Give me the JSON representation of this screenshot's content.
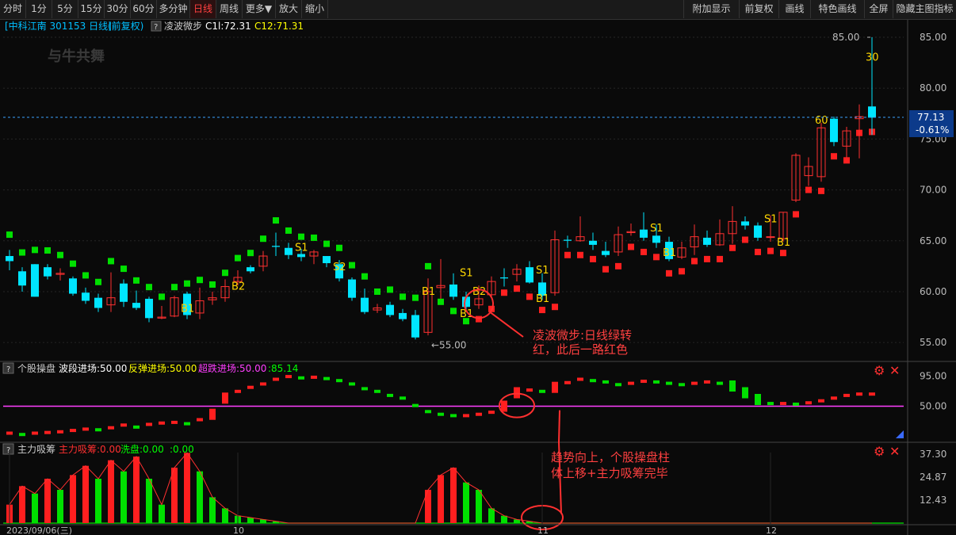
{
  "toolbar": {
    "left": [
      "分时",
      "1分",
      "5分",
      "15分",
      "30分",
      "60分",
      "多分钟",
      "日线",
      "周线",
      "更多▼",
      "放大",
      "缩小"
    ],
    "active": "日线",
    "right": [
      "附加显示",
      "前复权",
      "画线",
      "特色画线",
      "全屏",
      "隐藏主图指标"
    ]
  },
  "header": {
    "symbol": "[中科江南 301153 日线]",
    "adj": "(前复权)",
    "indicator": "凌波微步",
    "c1": "C1l:72.31",
    "c2": "C12:71.31"
  },
  "watermark": "与牛共舞",
  "price_panel": {
    "current": "77.13",
    "change": "-0.61%",
    "high_mark": "85.00",
    "low_mark": "55.00",
    "yticks": [
      "85.00",
      "80.00",
      "75.00",
      "70.00",
      "65.00",
      "60.00",
      "55.00"
    ],
    "candles": [
      [
        63.5,
        63,
        64.1,
        62.1
      ],
      [
        62.0,
        60.6,
        62.4,
        60.0
      ],
      [
        62.7,
        59.5,
        62.7,
        59.5
      ],
      [
        62.4,
        61.5,
        62.7,
        61.2
      ],
      [
        61.7,
        61.8,
        62.3,
        61.1
      ],
      [
        61.3,
        59.8,
        61.5,
        59.6
      ],
      [
        59.9,
        59.1,
        60.4,
        58.8
      ],
      [
        59.4,
        58.4,
        59.8,
        58.0
      ],
      [
        58.7,
        59.4,
        61.9,
        58.0
      ],
      [
        60.8,
        59.0,
        61.2,
        58.5
      ],
      [
        58.9,
        58.4,
        60.1,
        58.2
      ],
      [
        59.3,
        57.4,
        59.5,
        57.0
      ],
      [
        57.4,
        57.5,
        58.6,
        57.3
      ],
      [
        57.6,
        59.4,
        59.6,
        57.5
      ],
      [
        59.8,
        57.7,
        60.0,
        57.3
      ],
      [
        57.9,
        59.1,
        60.4,
        57.3
      ],
      [
        59.2,
        59.4,
        60.0,
        58.7
      ],
      [
        59.4,
        60.5,
        61.2,
        59.0
      ],
      [
        61.0,
        61.4,
        62.1,
        60.6
      ],
      [
        62.4,
        62.0,
        62.6,
        61.8
      ],
      [
        62.5,
        63.5,
        64.0,
        62.0
      ],
      [
        64.5,
        64.4,
        65.8,
        63.5
      ],
      [
        64.3,
        63.6,
        64.8,
        63.2
      ],
      [
        63.7,
        63.4,
        64.2,
        63.0
      ],
      [
        63.5,
        63.9,
        64.1,
        62.7
      ],
      [
        63.5,
        62.8,
        63.5,
        62.4
      ],
      [
        62.7,
        61.3,
        63.1,
        61.0
      ],
      [
        61.2,
        59.4,
        61.4,
        59.1
      ],
      [
        59.4,
        58.0,
        60.3,
        57.8
      ],
      [
        58.2,
        58.4,
        58.8,
        57.9
      ],
      [
        58.7,
        57.7,
        59.0,
        57.5
      ],
      [
        57.9,
        57.3,
        58.3,
        57.1
      ],
      [
        57.7,
        55.5,
        58.2,
        55.3
      ],
      [
        56.0,
        60.0,
        61.3,
        55.7
      ],
      [
        60.4,
        60.6,
        63.2,
        59.3
      ],
      [
        60.7,
        59.5,
        61.8,
        59.2
      ],
      [
        59.5,
        58.5,
        60.0,
        58.2
      ],
      [
        58.7,
        59.3,
        60.6,
        58.3
      ],
      [
        59.7,
        61.0,
        61.5,
        59.4
      ],
      [
        61.4,
        61.3,
        62.3,
        60.5
      ],
      [
        61.7,
        62.2,
        62.7,
        61.0
      ],
      [
        62.4,
        60.9,
        63.0,
        60.8
      ],
      [
        60.9,
        59.6,
        61.8,
        59.2
      ],
      [
        59.9,
        65.1,
        66.0,
        59.6
      ],
      [
        65.1,
        65.0,
        65.5,
        64.3
      ],
      [
        65.0,
        65.4,
        67.4,
        64.9
      ],
      [
        65.0,
        64.6,
        65.8,
        64.1
      ],
      [
        64.0,
        63.6,
        64.9,
        63.4
      ],
      [
        63.9,
        65.6,
        66.4,
        63.5
      ],
      [
        65.8,
        65.9,
        66.7,
        65.5
      ],
      [
        66.1,
        65.3,
        67.8,
        65.0
      ],
      [
        65.5,
        64.8,
        66.6,
        64.3
      ],
      [
        64.9,
        63.2,
        65.4,
        63.0
      ],
      [
        63.4,
        64.3,
        64.9,
        63.2
      ],
      [
        64.4,
        65.4,
        66.6,
        63.6
      ],
      [
        65.3,
        64.6,
        66.0,
        64.4
      ],
      [
        64.6,
        65.7,
        67.1,
        64.5
      ],
      [
        65.7,
        66.9,
        68.4,
        64.7
      ],
      [
        66.9,
        66.5,
        67.4,
        66.1
      ],
      [
        66.5,
        65.3,
        66.8,
        65.0
      ],
      [
        65.4,
        65.4,
        67.5,
        64.9
      ],
      [
        65.2,
        67.8,
        67.8,
        64.9
      ],
      [
        69.0,
        73.4,
        73.6,
        68.8
      ],
      [
        71.4,
        72.3,
        73.2,
        70.4
      ],
      [
        71.3,
        76.1,
        76.6,
        70.8
      ],
      [
        77.0,
        74.7,
        77.2,
        74.3
      ],
      [
        74.3,
        75.8,
        76.2,
        73.2
      ],
      [
        77.0,
        77.2,
        78.4,
        73.1
      ],
      [
        78.2,
        77.1,
        85.0,
        75.4
      ]
    ],
    "signals": [
      [
        18,
        "B2",
        60.2
      ],
      [
        14,
        "B1",
        58.0
      ],
      [
        23,
        "S1",
        64.0
      ],
      [
        26,
        "S2",
        62.1
      ],
      [
        33,
        "B1",
        59.7
      ],
      [
        36,
        "S1",
        61.5
      ],
      [
        36,
        "B1",
        57.5
      ],
      [
        37,
        "B2",
        59.7
      ],
      [
        42,
        "S1",
        61.8
      ],
      [
        42,
        "B1",
        59.0
      ],
      [
        51,
        "S1",
        65.9
      ],
      [
        52,
        "B1",
        63.5
      ],
      [
        60,
        "S1",
        66.8
      ],
      [
        61,
        "B1",
        64.5
      ],
      [
        64,
        "60",
        76.5
      ],
      [
        68,
        "30",
        82.7
      ]
    ]
  },
  "indicator1": {
    "title": "个股操盘",
    "legend": [
      {
        "label": "波段进场:50.00",
        "color": "#ffffff"
      },
      {
        "label": "反弹进场:50.00",
        "color": "#ffff00"
      },
      {
        "label": "超跌进场:50.00",
        "color": "#ff3fff"
      },
      {
        "label": ":85.14",
        "color": "#00ff00"
      }
    ],
    "yticks": [
      "95.00",
      "50.00"
    ],
    "values": [
      10,
      8,
      10,
      11,
      12,
      14,
      16,
      15,
      18,
      22,
      19,
      23,
      25,
      26,
      24,
      30,
      38,
      62,
      72,
      78,
      83,
      90,
      94,
      92,
      93,
      91,
      88,
      83,
      76,
      72,
      66,
      62,
      51,
      42,
      38,
      36,
      36,
      38,
      41,
      50,
      70,
      74,
      72,
      78,
      85,
      90,
      88,
      86,
      82,
      84,
      87,
      86,
      84,
      82,
      84,
      86,
      84,
      80,
      70,
      60,
      54,
      54,
      53,
      55,
      58,
      62,
      66,
      68,
      68,
      66,
      64,
      60,
      58,
      65,
      75,
      85,
      90,
      92,
      88,
      86,
      85.14
    ]
  },
  "indicator2": {
    "title": "主力吸筹",
    "legend": [
      {
        "label": "主力吸筹:0.00",
        "color": "#ff3030"
      },
      {
        "label": "洗盘:0.00",
        "color": "#00ff00"
      },
      {
        "label": ":0.00",
        "color": "#00ff00"
      }
    ],
    "yticks": [
      "37.30",
      "24.87",
      "12.43"
    ],
    "values": [
      10,
      20,
      16,
      24,
      18,
      26,
      31,
      24,
      34,
      28,
      36,
      24,
      10,
      30,
      38,
      28,
      14,
      8,
      4,
      3,
      2,
      1,
      0,
      0,
      0,
      0,
      0,
      0,
      0,
      0,
      0,
      0,
      0,
      18,
      26,
      30,
      22,
      18,
      8,
      4,
      2,
      1,
      0,
      0,
      0,
      0,
      0,
      0,
      0,
      0,
      0,
      0,
      0,
      0,
      0,
      0,
      0,
      0,
      0,
      0,
      0,
      0,
      0,
      0,
      0,
      0,
      0,
      0,
      0,
      0,
      0,
      0,
      0,
      0,
      0,
      0,
      0,
      0,
      0,
      0,
      0
    ]
  },
  "x_labels": [
    {
      "text": "2023/09/06(三)",
      "i": 0
    },
    {
      "text": "10",
      "i": 18
    },
    {
      "text": "11",
      "i": 42
    },
    {
      "text": "12",
      "i": 60
    }
  ],
  "annotations": [
    {
      "text": "凌波微步:日线绿转",
      "text2": "红，此后一路红色"
    },
    {
      "text": "趋势向上，个股操盘柱",
      "text2": "体上移+主力吸筹完毕"
    }
  ],
  "colors": {
    "up": "#ff3030",
    "down": "#00e5ff",
    "green": "#00e000",
    "bg": "#0a0a0a",
    "yellow": "#ffd700",
    "purple": "#ff3fff"
  }
}
